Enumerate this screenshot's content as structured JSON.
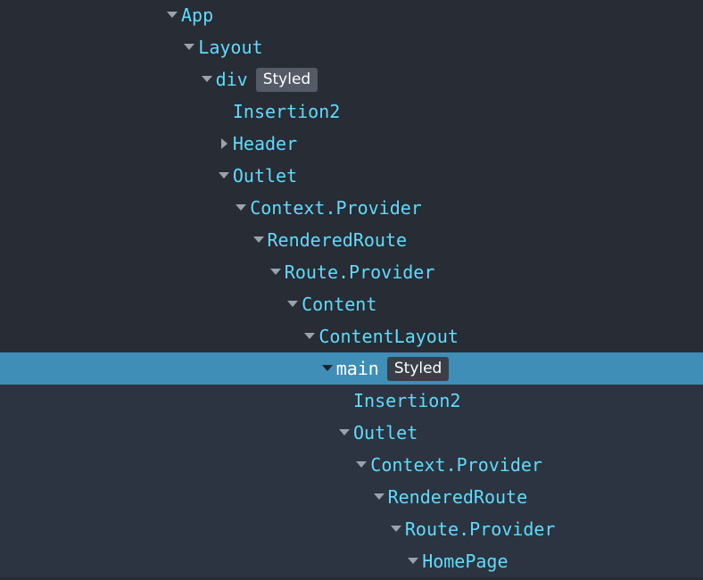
{
  "nodes": [
    {
      "label": "App",
      "badge": "",
      "arrow": "expanded",
      "level": 0
    },
    {
      "label": "Layout",
      "badge": "",
      "arrow": "expanded",
      "level": 1
    },
    {
      "label": "div",
      "badge": "Styled",
      "arrow": "expanded",
      "level": 2
    },
    {
      "label": "Insertion2",
      "badge": "",
      "arrow": "none",
      "level": 3
    },
    {
      "label": "Header",
      "badge": "",
      "arrow": "collapsed",
      "level": 3
    },
    {
      "label": "Outlet",
      "badge": "",
      "arrow": "expanded",
      "level": 3
    },
    {
      "label": "Context.Provider",
      "badge": "",
      "arrow": "expanded",
      "level": 4
    },
    {
      "label": "RenderedRoute",
      "badge": "",
      "arrow": "expanded",
      "level": 5
    },
    {
      "label": "Route.Provider",
      "badge": "",
      "arrow": "expanded",
      "level": 6
    },
    {
      "label": "Content",
      "badge": "",
      "arrow": "expanded",
      "level": 7
    },
    {
      "label": "ContentLayout",
      "badge": "",
      "arrow": "expanded",
      "level": 8
    },
    {
      "label": "main",
      "badge": "Styled",
      "arrow": "expanded",
      "level": 9,
      "selected": true
    },
    {
      "label": "Insertion2",
      "badge": "",
      "arrow": "none",
      "level": 10
    },
    {
      "label": "Outlet",
      "badge": "",
      "arrow": "expanded",
      "level": 10
    },
    {
      "label": "Context.Provider",
      "badge": "",
      "arrow": "expanded",
      "level": 11
    },
    {
      "label": "RenderedRoute",
      "badge": "",
      "arrow": "expanded",
      "level": 12
    },
    {
      "label": "Route.Provider",
      "badge": "",
      "arrow": "expanded",
      "level": 13
    },
    {
      "label": "HomePage",
      "badge": "",
      "arrow": "expanded",
      "level": 14
    }
  ],
  "colors": {
    "background": "#282c34",
    "subtree_background": "#2b3440",
    "selected_background": "#3f8eb8",
    "component_name": "#61dafb",
    "badge_background": "#545b66"
  }
}
